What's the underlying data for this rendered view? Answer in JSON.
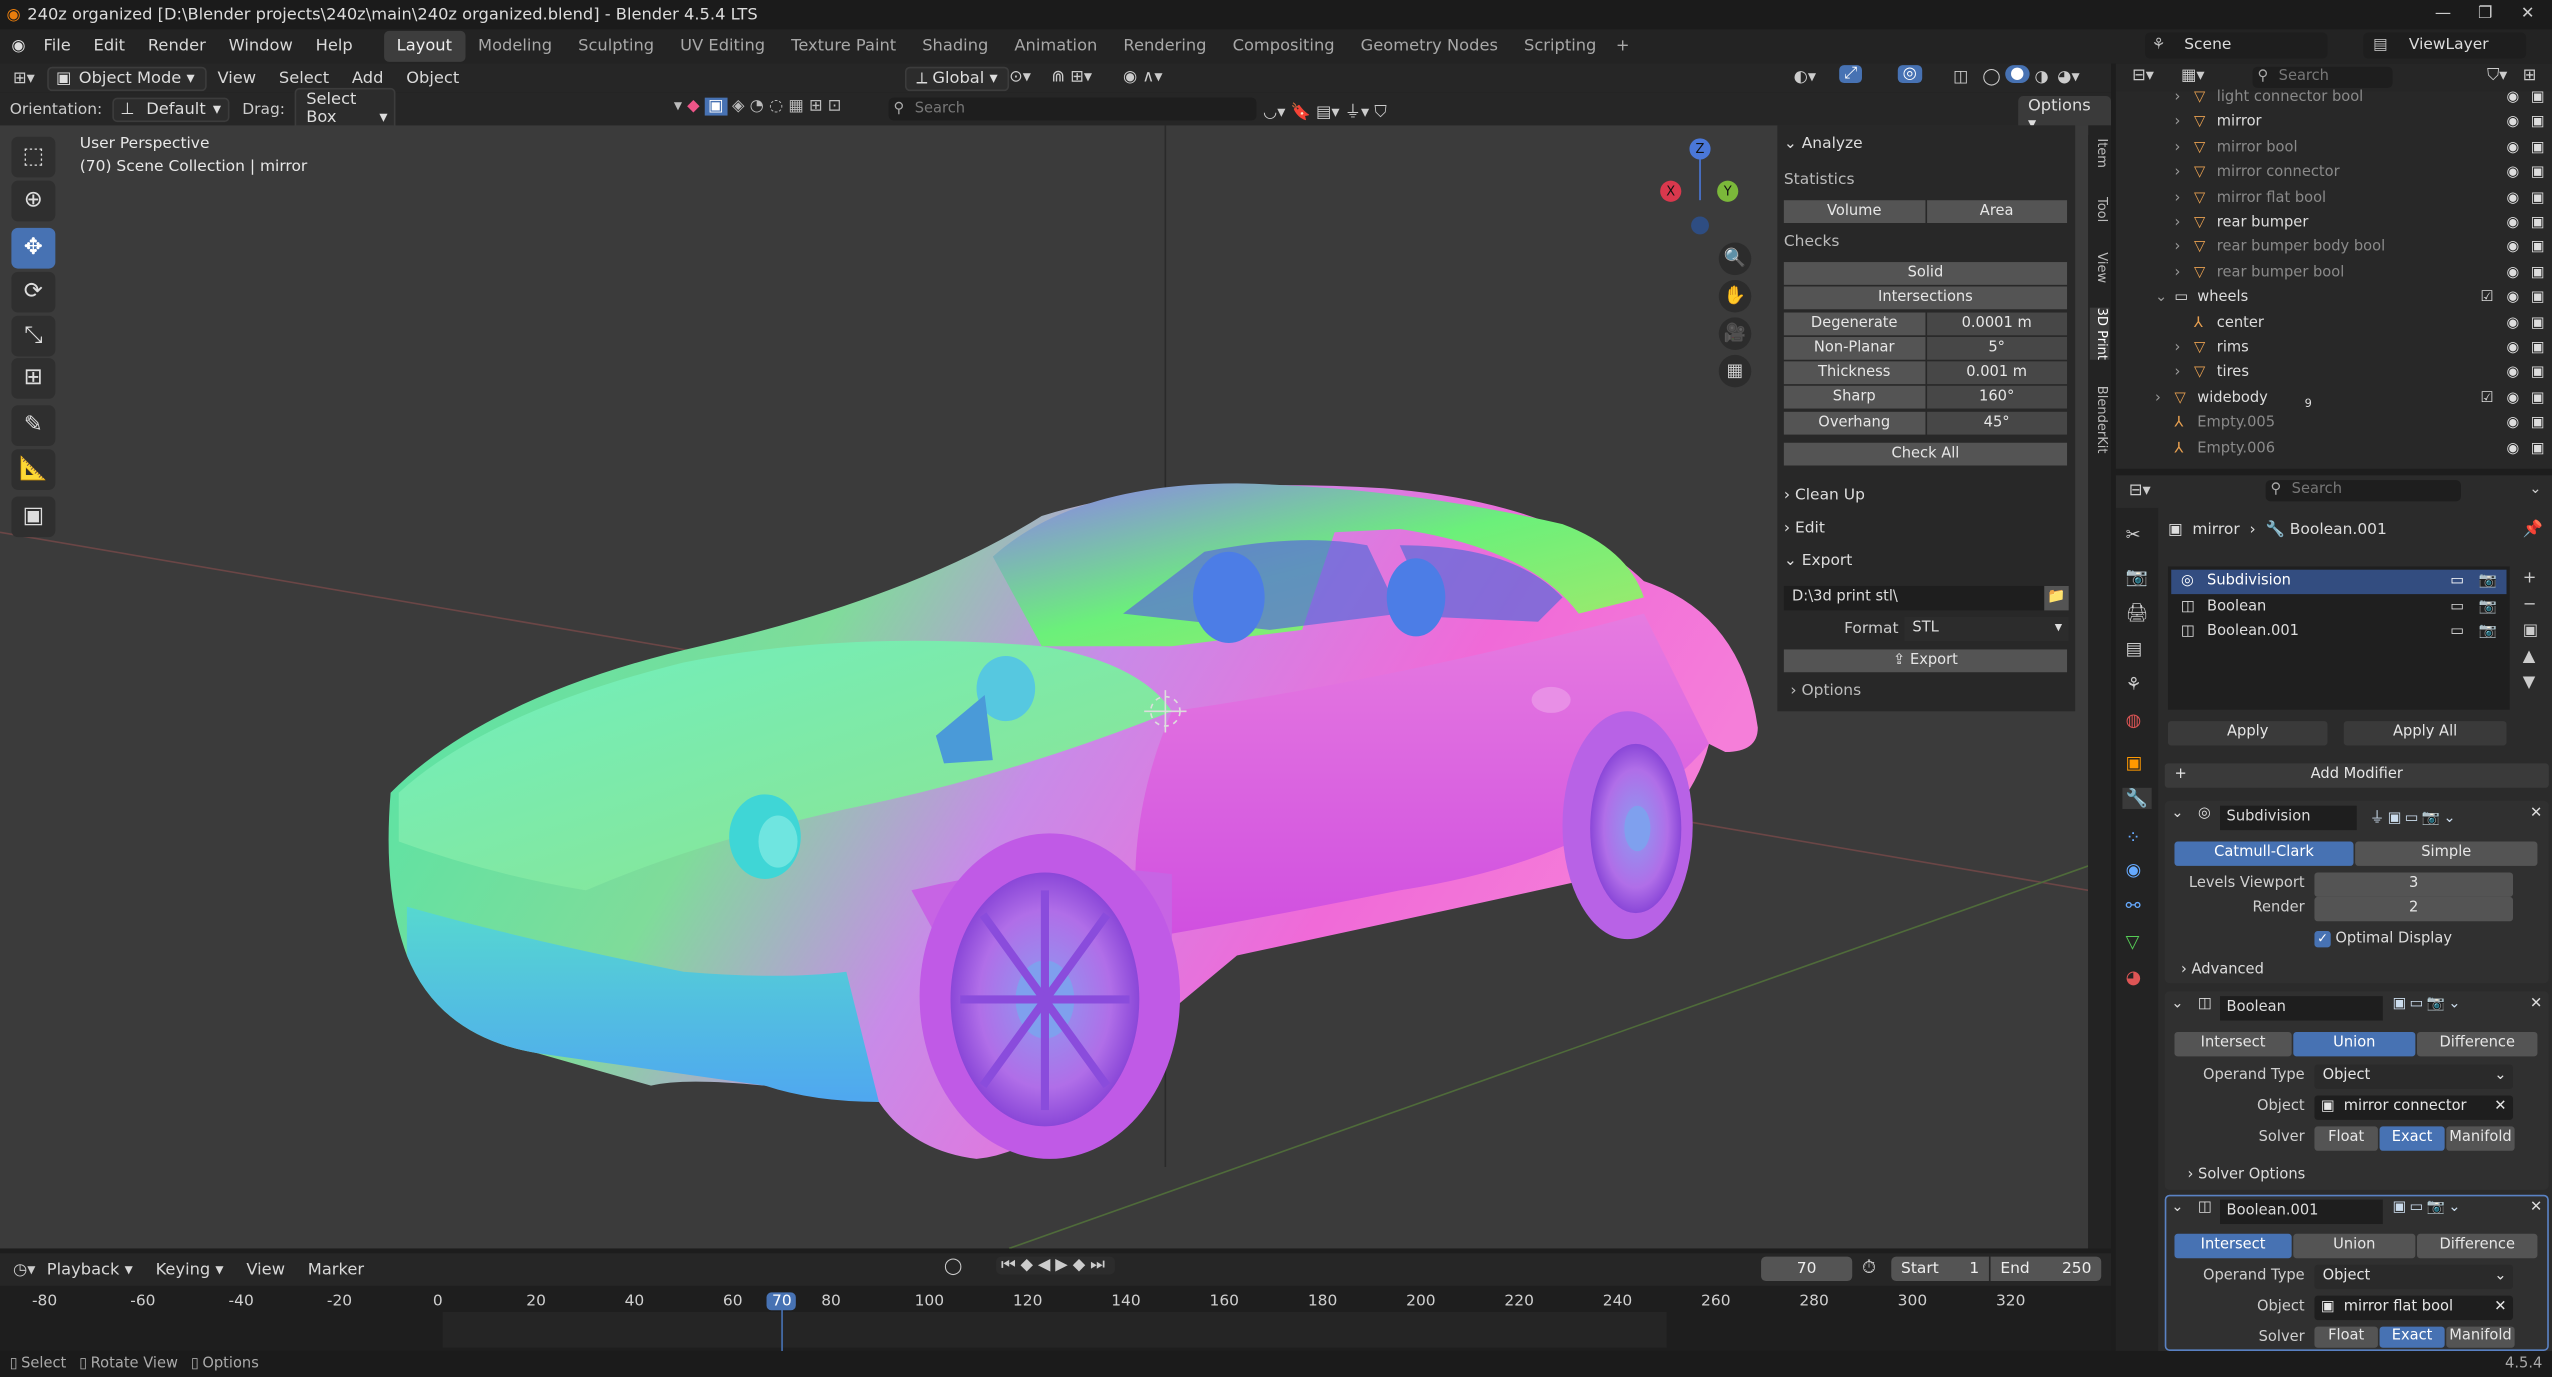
{
  "title_bar": {
    "text": "240z organized [D:\\Blender projects\\240z\\main\\240z organized.blend] - Blender 4.5.4 LTS"
  },
  "menu": [
    "File",
    "Edit",
    "Render",
    "Window",
    "Help"
  ],
  "workspaces": [
    "Layout",
    "Modeling",
    "Sculpting",
    "UV Editing",
    "Texture Paint",
    "Shading",
    "Animation",
    "Rendering",
    "Compositing",
    "Geometry Nodes",
    "Scripting"
  ],
  "active_workspace": "Layout",
  "scene": {
    "label": "Scene",
    "view_layer": "ViewLayer"
  },
  "viewport_header": {
    "mode": "Object Mode",
    "menus": [
      "View",
      "Select",
      "Add",
      "Object"
    ],
    "transform": "Global",
    "options": "Options"
  },
  "tool_settings": {
    "orientation_label": "Orientation:",
    "orientation": "Default",
    "drag_label": "Drag:",
    "drag": "Select Box",
    "search_placeholder": "Search"
  },
  "viewport_info": {
    "line1": "User Perspective",
    "line2": "(70) Scene Collection | mirror"
  },
  "gizmo": {
    "z": "Z",
    "x": "X",
    "y": "Y"
  },
  "print3d": {
    "analyze": "Analyze",
    "statistics": "Statistics",
    "volume": "Volume",
    "area": "Area",
    "checks": "Checks",
    "solid": "Solid",
    "intersections": "Intersections",
    "rows": [
      {
        "label": "Degenerate",
        "value": "0.0001 m"
      },
      {
        "label": "Non-Planar",
        "value": "5°"
      },
      {
        "label": "Thickness",
        "value": "0.001 m"
      },
      {
        "label": "Sharp",
        "value": "160°"
      },
      {
        "label": "Overhang",
        "value": "45°"
      }
    ],
    "check_all": "Check All",
    "clean_up": "Clean Up",
    "edit": "Edit",
    "export": "Export",
    "export_path": "D:\\3d print stl\\",
    "format_label": "Format",
    "format": "STL",
    "export_button": "Export",
    "options": "Options"
  },
  "side_tabs": [
    "Item",
    "Tool",
    "View",
    "3D Print",
    "BlenderKit"
  ],
  "outliner": {
    "search_placeholder": "Search",
    "items": [
      {
        "name": "light connector bool",
        "dim": true
      },
      {
        "name": "mirror",
        "dim": false
      },
      {
        "name": "mirror bool",
        "dim": true
      },
      {
        "name": "mirror connector",
        "dim": true
      },
      {
        "name": "mirror flat bool",
        "dim": true
      },
      {
        "name": "rear bumper",
        "dim": false
      },
      {
        "name": "rear bumper body bool",
        "dim": true
      },
      {
        "name": "rear bumper bool",
        "dim": true
      },
      {
        "name": "wheels",
        "dim": false
      },
      {
        "name": "center",
        "dim": false
      },
      {
        "name": "rims",
        "dim": false
      },
      {
        "name": "tires",
        "dim": false
      },
      {
        "name": "widebody",
        "dim": false
      },
      {
        "name": "Empty.005",
        "dim": true
      },
      {
        "name": "Empty.006",
        "dim": true
      }
    ],
    "widebody_badge": "9"
  },
  "properties": {
    "search_placeholder": "Search",
    "breadcrumb_object": "mirror",
    "breadcrumb_modifier": "Boolean.001",
    "modifier_list": [
      "Subdivision",
      "Boolean",
      "Boolean.001"
    ],
    "apply": "Apply",
    "apply_all": "Apply All",
    "add_modifier": "Add Modifier",
    "subdivision": {
      "name": "Subdivision",
      "catmull": "Catmull-Clark",
      "simple": "Simple",
      "levels_label": "Levels Viewport",
      "levels": "3",
      "render_label": "Render",
      "render": "2",
      "optimal": "Optimal Display",
      "advanced": "Advanced"
    },
    "boolean": {
      "name": "Boolean",
      "ops": [
        "Intersect",
        "Union",
        "Difference"
      ],
      "active_op": "Union",
      "operand_label": "Operand Type",
      "operand": "Object",
      "object_label": "Object",
      "object": "mirror connector",
      "solver_label": "Solver",
      "solvers": [
        "Float",
        "Exact",
        "Manifold"
      ],
      "active_solver": "Exact",
      "solver_options": "Solver Options"
    },
    "boolean001": {
      "name": "Boolean.001",
      "ops": [
        "Intersect",
        "Union",
        "Difference"
      ],
      "active_op": "Intersect",
      "operand_label": "Operand Type",
      "operand": "Object",
      "object_label": "Object",
      "object": "mirror flat bool",
      "solver_label": "Solver",
      "solvers": [
        "Float",
        "Exact",
        "Manifold"
      ],
      "active_solver": "Exact"
    }
  },
  "timeline": {
    "menus": [
      "Playback",
      "Keying",
      "View",
      "Marker"
    ],
    "current_frame": "70",
    "start_label": "Start",
    "start": "1",
    "end_label": "End",
    "end": "250",
    "ticks": [
      "-80",
      "-60",
      "-40",
      "-20",
      "0",
      "20",
      "40",
      "60",
      "70",
      "80",
      "100",
      "120",
      "140",
      "160",
      "180",
      "200",
      "220",
      "240",
      "260",
      "280",
      "300",
      "320"
    ]
  },
  "statusbar": {
    "select": "Select",
    "rotate": "Rotate View",
    "options": "Options",
    "version": "4.5.4"
  }
}
